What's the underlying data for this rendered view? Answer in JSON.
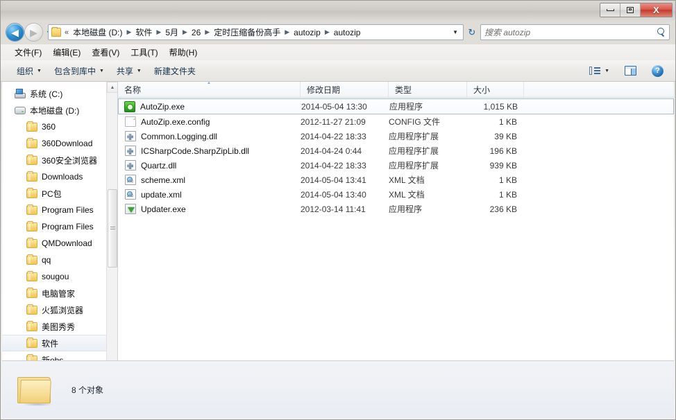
{
  "window": {
    "controls": {
      "minimize": "minimize",
      "maximize": "maximize",
      "close": "X"
    }
  },
  "nav": {
    "back_label": "◀",
    "forward_label": "▶",
    "history_caret": "▼",
    "refresh_label": "↻",
    "breadcrumb_prefix": "«",
    "breadcrumb": [
      "本地磁盘 (D:)",
      "软件",
      "5月",
      "26",
      "定时压缩备份高手",
      "autozip",
      "autozip"
    ],
    "breadcrumb_separator": "▶",
    "breadcrumb_caret": "▼"
  },
  "search": {
    "placeholder": "搜索 autozip",
    "value": ""
  },
  "menubar": {
    "items": [
      {
        "label": "文件(F)"
      },
      {
        "label": "编辑(E)"
      },
      {
        "label": "查看(V)"
      },
      {
        "label": "工具(T)"
      },
      {
        "label": "帮助(H)"
      }
    ]
  },
  "toolbar": {
    "items": [
      {
        "label": "组织",
        "caret": "▼"
      },
      {
        "label": "包含到库中",
        "caret": "▼"
      },
      {
        "label": "共享",
        "caret": "▼"
      },
      {
        "label": "新建文件夹",
        "caret": ""
      }
    ],
    "view_caret": "▼",
    "help_glyph": "?"
  },
  "sidebar": {
    "items": [
      {
        "label": "系统 (C:)",
        "icon": "system-drive-icon",
        "indent": false,
        "selected": false
      },
      {
        "label": "本地磁盘 (D:)",
        "icon": "drive-icon",
        "indent": false,
        "selected": false
      },
      {
        "label": "360",
        "icon": "folder-icon",
        "indent": true,
        "selected": false
      },
      {
        "label": "360Download",
        "icon": "folder-icon",
        "indent": true,
        "selected": false
      },
      {
        "label": "360安全浏览器",
        "icon": "folder-icon",
        "indent": true,
        "selected": false
      },
      {
        "label": "Downloads",
        "icon": "folder-icon",
        "indent": true,
        "selected": false
      },
      {
        "label": "PC包",
        "icon": "folder-icon",
        "indent": true,
        "selected": false
      },
      {
        "label": "Program Files",
        "icon": "folder-icon",
        "indent": true,
        "selected": false
      },
      {
        "label": "Program Files",
        "icon": "folder-icon",
        "indent": true,
        "selected": false
      },
      {
        "label": "QMDownload",
        "icon": "folder-icon",
        "indent": true,
        "selected": false
      },
      {
        "label": "qq",
        "icon": "folder-icon",
        "indent": true,
        "selected": false
      },
      {
        "label": "sougou",
        "icon": "folder-icon",
        "indent": true,
        "selected": false
      },
      {
        "label": "电脑管家",
        "icon": "folder-icon",
        "indent": true,
        "selected": false
      },
      {
        "label": "火狐浏览器",
        "icon": "folder-icon",
        "indent": true,
        "selected": false
      },
      {
        "label": "美图秀秀",
        "icon": "folder-icon",
        "indent": true,
        "selected": false
      },
      {
        "label": "软件",
        "icon": "folder-icon",
        "indent": true,
        "selected": true
      },
      {
        "label": "新obs",
        "icon": "folder-icon",
        "indent": true,
        "selected": false
      }
    ],
    "scroll_up": "▲",
    "scroll_down": "▼"
  },
  "filelist": {
    "columns": [
      {
        "label": "名称",
        "key": "name",
        "sorted": true
      },
      {
        "label": "修改日期",
        "key": "date",
        "sorted": false
      },
      {
        "label": "类型",
        "key": "type",
        "sorted": false
      },
      {
        "label": "大小",
        "key": "size",
        "sorted": false
      }
    ],
    "rows": [
      {
        "name": "AutoZip.exe",
        "date": "2014-05-04 13:30",
        "type": "应用程序",
        "size": "1,015 KB",
        "icon": "app-green-icon",
        "selected": true
      },
      {
        "name": "AutoZip.exe.config",
        "date": "2012-11-27 21:09",
        "type": "CONFIG 文件",
        "size": "1 KB",
        "icon": "document-icon",
        "selected": false
      },
      {
        "name": "Common.Logging.dll",
        "date": "2014-04-22 18:33",
        "type": "应用程序扩展",
        "size": "39 KB",
        "icon": "dll-icon",
        "selected": false
      },
      {
        "name": "ICSharpCode.SharpZipLib.dll",
        "date": "2014-04-24 0:44",
        "type": "应用程序扩展",
        "size": "196 KB",
        "icon": "dll-icon",
        "selected": false
      },
      {
        "name": "Quartz.dll",
        "date": "2014-04-22 18:33",
        "type": "应用程序扩展",
        "size": "939 KB",
        "icon": "dll-icon",
        "selected": false
      },
      {
        "name": "scheme.xml",
        "date": "2014-05-04 13:41",
        "type": "XML 文档",
        "size": "1 KB",
        "icon": "xml-icon",
        "selected": false
      },
      {
        "name": "update.xml",
        "date": "2014-05-04 13:40",
        "type": "XML 文档",
        "size": "1 KB",
        "icon": "xml-icon",
        "selected": false
      },
      {
        "name": "Updater.exe",
        "date": "2012-03-14 11:41",
        "type": "应用程序",
        "size": "236 KB",
        "icon": "updater-icon",
        "selected": false
      }
    ]
  },
  "details": {
    "text": "8 个对象"
  }
}
